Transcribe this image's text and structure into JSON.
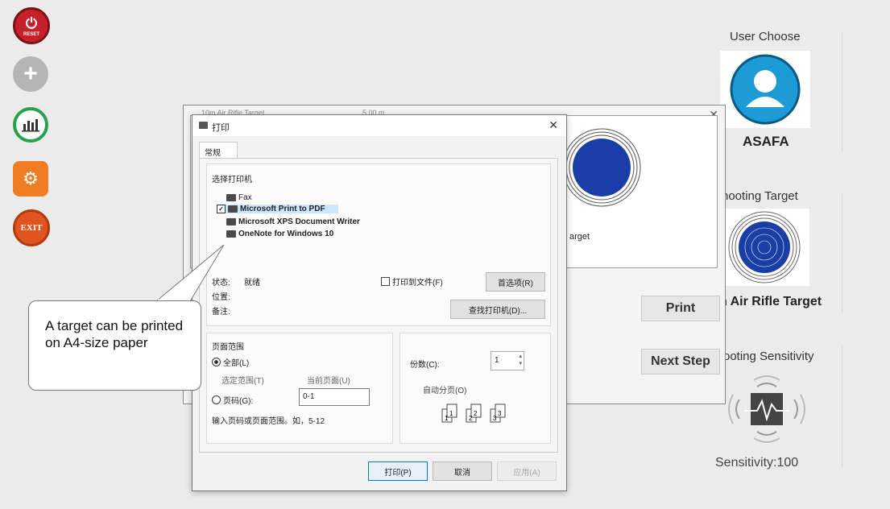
{
  "toolbar": {
    "reset_label": "RESET",
    "exit_label": "EXIT",
    "chart_icon": "bar-chart-icon",
    "colors": {
      "reset": "#c8202a",
      "add": "#b5b5b5",
      "stats": "#27a24a",
      "settings": "#f07d22",
      "exit": "#e0541d"
    }
  },
  "right_panel": {
    "user_choose_label": "User Choose",
    "user_name": "ASAFA",
    "shooting_target_label": "hooting Target",
    "target_name": "n Air Rifle Target",
    "sensitivity_label": "ooting Sensitivity",
    "sensitivity_value": "Sensitivity:100",
    "user_icon_color": "#1c9bd7",
    "target_color": "#1a3ea6"
  },
  "back_dialog": {
    "header_row_name": "10m Air Rifle Target",
    "header_row_value": "5.00 m",
    "target_caption": "arget",
    "print_button": "Print",
    "next_step_button": "Next Step"
  },
  "print_dialog": {
    "title": "打印",
    "tab_general": "常规",
    "select_printer_label": "选择打印机",
    "printers": [
      "Fax",
      "Microsoft Print to PDF",
      "Microsoft XPS Document Writer",
      "OneNote for Windows 10"
    ],
    "selected_printer_index": 1,
    "status_label": "状态:",
    "status_value": "就绪",
    "location_label": "位置:",
    "comment_label": "备注:",
    "print_to_file_label": "打印到文件(F)",
    "preferences_button": "首选项(R)",
    "find_printer_button": "查找打印机(D)...",
    "page_range_label": "页面范围",
    "all_label": "全部(L)",
    "selection_label": "选定范围(T)",
    "current_page_label": "当前页面(U)",
    "pages_label": "页码(G):",
    "pages_value": "0-1",
    "pages_hint": "输入页码或页面范围。如，5-12",
    "copies_label": "份数(C):",
    "copies_value": "1",
    "collate_label": "自动分页(O)",
    "print_button": "打印(P)",
    "cancel_button": "取消",
    "apply_button": "应用(A)"
  },
  "callout": {
    "text": "A target can be printed on A4-size paper"
  }
}
